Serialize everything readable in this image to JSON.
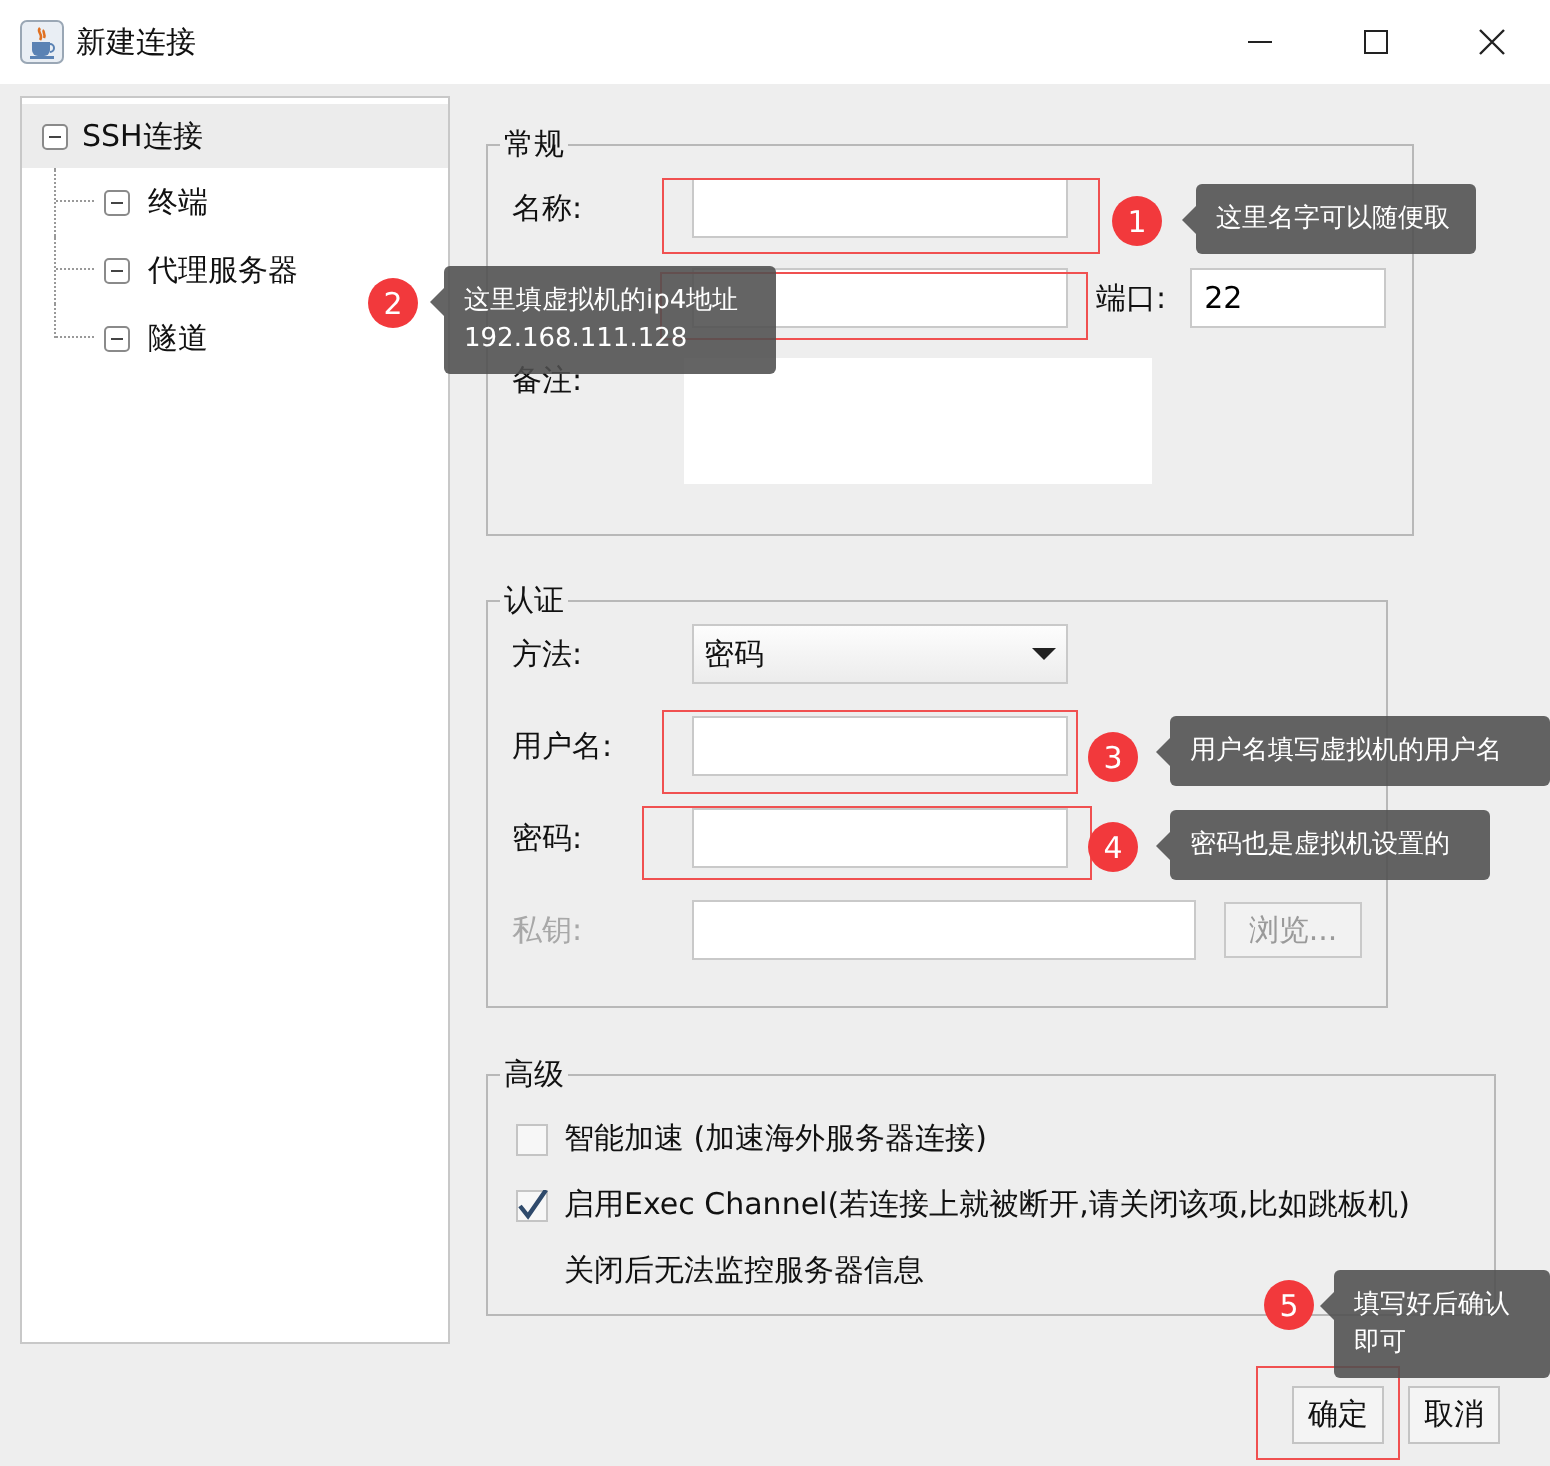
{
  "window": {
    "title": "新建连接"
  },
  "tree": [
    {
      "label": "SSH连接",
      "expanded": true,
      "selected": true,
      "children": [
        {
          "label": "终端",
          "expanded": true,
          "selected": false
        },
        {
          "label": "代理服务器",
          "expanded": true,
          "selected": false
        },
        {
          "label": "隧道",
          "expanded": true,
          "selected": false
        }
      ]
    }
  ],
  "general": {
    "title": "常规",
    "name": {
      "label": "名称:"
    },
    "port": {
      "label": "端口:",
      "value": "22"
    },
    "note": {
      "label": "备注:"
    }
  },
  "auth": {
    "title": "认证",
    "fields": [
      {
        "kind": "select",
        "label": "方法:",
        "value": "密码"
      },
      {
        "kind": "text",
        "label": "用户名:"
      },
      {
        "kind": "text",
        "label": "密码:"
      },
      {
        "kind": "file",
        "label": "私钥:",
        "disabled": true,
        "button": "浏览..."
      }
    ]
  },
  "advanced": {
    "title": "高级",
    "options": [
      {
        "label": "智能加速 (加速海外服务器连接)",
        "checked": false
      },
      {
        "label": "启用Exec Channel(若连接上就被断开,请关闭该项,比如跳板机)",
        "checked": true,
        "note": "关闭后无法监控服务器信息"
      }
    ]
  },
  "buttons": [
    {
      "label": "确定"
    },
    {
      "label": "取消"
    }
  ],
  "annotations": [
    {
      "number": "1",
      "lines": [
        "这里名字可以随便取"
      ]
    },
    {
      "number": "2",
      "lines": [
        "这里填虚拟机的ip4地址",
        "192.168.111.128"
      ]
    },
    {
      "number": "3",
      "lines": [
        "用户名填写虚拟机的用户名"
      ]
    },
    {
      "number": "4",
      "lines": [
        "密码也是虚拟机设置的"
      ]
    },
    {
      "number": "5",
      "lines": [
        "填写好后确认",
        "即可"
      ]
    }
  ]
}
